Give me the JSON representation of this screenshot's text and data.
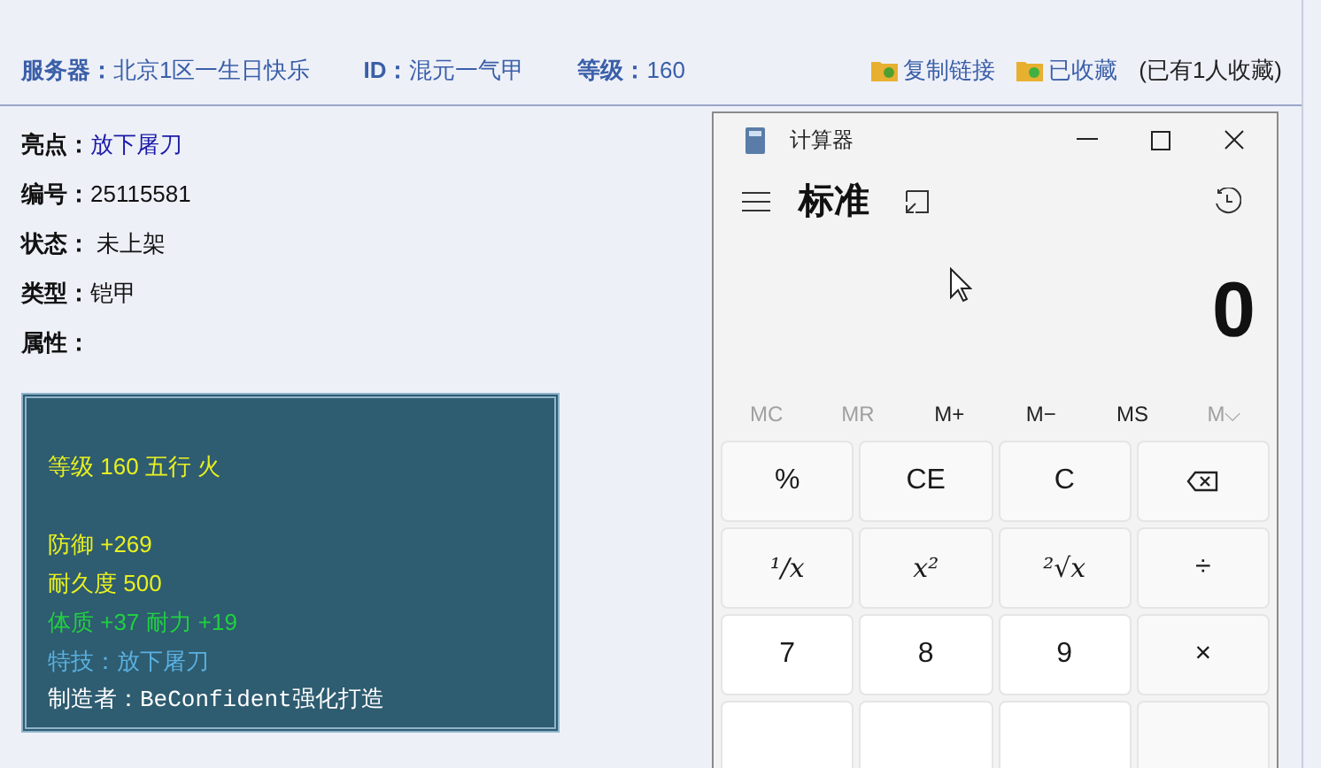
{
  "header": {
    "fields": [
      {
        "label": "服务器：",
        "value": "北京1区一生日快乐"
      },
      {
        "label": "ID：",
        "value": "混元一气甲"
      },
      {
        "label": "等级：",
        "value": "160"
      }
    ],
    "actions": [
      {
        "label": "复制链接"
      },
      {
        "label": "已收藏"
      }
    ],
    "note": "(已有1人收藏)"
  },
  "details": [
    {
      "label": "亮点：",
      "value": "放下屠刀",
      "kind": "link"
    },
    {
      "label": "编号：",
      "value": "25115581",
      "kind": "plain"
    },
    {
      "label": "状态：",
      "value": " 未上架",
      "kind": "plain"
    },
    {
      "label": "类型：",
      "value": "铠甲",
      "kind": "plain"
    },
    {
      "label": "属性："
    }
  ],
  "tooltip": {
    "lines": [
      {
        "kind": "text",
        "text": "等级 160 五行 火",
        "color": "#e8f020"
      },
      {
        "kind": "gap"
      },
      {
        "kind": "text",
        "text": "防御 +269",
        "color": "#e8f020"
      },
      {
        "kind": "text",
        "text": "耐久度 500",
        "color": "#e8f020"
      },
      {
        "kind": "text",
        "text": "体质 +37 耐力 +19",
        "color": "#20d040"
      },
      {
        "kind": "text",
        "text": "特技：放下屠刀",
        "color": "#5ab0e0"
      },
      {
        "kind": "text",
        "text": "制造者：BeConfident强化打造",
        "color": "#ffffff",
        "mono": true
      }
    ]
  },
  "calculator": {
    "title": "计算器",
    "mode": "标准",
    "display": "0",
    "memory": [
      {
        "label": "MC",
        "disabled": true
      },
      {
        "label": "MR",
        "disabled": true
      },
      {
        "label": "M+",
        "disabled": false
      },
      {
        "label": "M−",
        "disabled": false
      },
      {
        "label": "MS",
        "disabled": false
      },
      {
        "label": "M⌵",
        "disabled": true
      }
    ],
    "keys": [
      {
        "label": "%",
        "kind": "function"
      },
      {
        "label": "CE",
        "kind": "function"
      },
      {
        "label": "C",
        "kind": "function"
      },
      {
        "kind": "backspace"
      },
      {
        "label": "¹/x",
        "kind": "function",
        "italic": true
      },
      {
        "label": "x²",
        "kind": "function",
        "italic": true
      },
      {
        "label": "²√x",
        "kind": "function",
        "italic": true
      },
      {
        "label": "÷",
        "kind": "function"
      },
      {
        "label": "7",
        "kind": "digit"
      },
      {
        "label": "8",
        "kind": "digit"
      },
      {
        "label": "9",
        "kind": "digit"
      },
      {
        "label": "×",
        "kind": "function"
      },
      {
        "kind": "digit"
      },
      {
        "kind": "digit"
      },
      {
        "kind": "digit"
      },
      {
        "kind": "function"
      }
    ]
  }
}
